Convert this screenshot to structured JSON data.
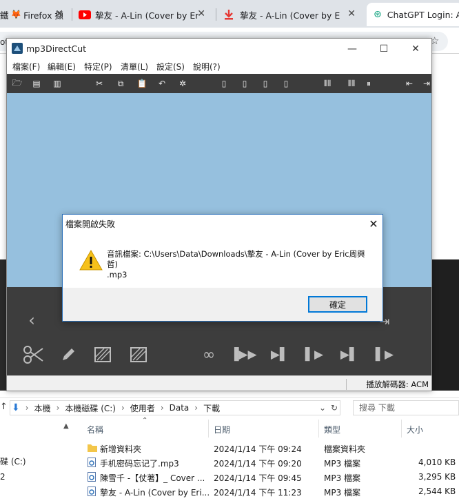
{
  "browser": {
    "tabs": [
      {
        "title": "Firefox 擷",
        "icon": "firefox-icon"
      },
      {
        "title": "摯友 - A-Lin (Cover by Eric周",
        "icon": "youtube-icon"
      },
      {
        "title": "摯友 - A-Lin (Cover by Eric周",
        "icon": "download-icon"
      },
      {
        "title": "ChatGPT Login: Ac",
        "icon": "chatgpt-icon"
      }
    ],
    "left_fragments": [
      "鐵",
      "ot"
    ]
  },
  "app": {
    "title": "mp3DirectCut",
    "menu": [
      "檔案(F)",
      "編輯(E)",
      "特定(P)",
      "清單(L)",
      "設定(S)",
      "說明(?)"
    ],
    "status": "播放解碼器: ACM"
  },
  "dialog": {
    "title": "檔案開啟失敗",
    "message_line1": "音訊檔案: C:\\Users\\Data\\Downloads\\摯友 - A-Lin (Cover by Eric周興哲)",
    "message_line2": ".mp3",
    "ok_label": "確定",
    "colors": {
      "warning": "#f6c11b",
      "accent": "#0078d7"
    }
  },
  "explorer": {
    "breadcrumb": [
      "本機",
      "本機磁碟 (C:)",
      "使用者",
      "Data",
      "下載"
    ],
    "search_placeholder": "搜尋 下載",
    "columns": [
      "名稱",
      "日期",
      "類型",
      "大小"
    ],
    "rows": [
      {
        "name": "新增資料夾",
        "date": "2024/1/14 下午 09:24",
        "type": "檔案資料夾",
        "size": "",
        "icon": "folder-icon"
      },
      {
        "name": "手机密码忘记了.mp3",
        "date": "2024/1/14 下午 09:20",
        "type": "MP3 檔案",
        "size": "4,010 KB",
        "icon": "audio-file-icon"
      },
      {
        "name": "陳雪千 -【仗著】_ Cover ...",
        "date": "2024/1/14 下午 09:45",
        "type": "MP3 檔案",
        "size": "3,295 KB",
        "icon": "audio-file-icon"
      },
      {
        "name": "摯友 - A-Lin (Cover by Eri...",
        "date": "2024/1/14 下午 11:23",
        "type": "MP3 檔案",
        "size": "2,544 KB",
        "icon": "audio-file-icon"
      }
    ],
    "sidebar": [
      "碟 (C:)",
      "2"
    ]
  }
}
